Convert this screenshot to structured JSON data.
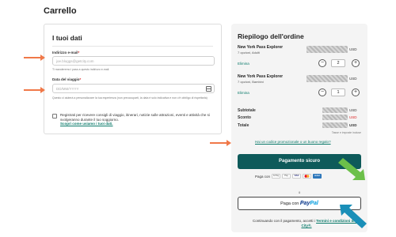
{
  "page": {
    "title": "Carrello"
  },
  "your_data": {
    "title": "I tuoi dati",
    "email": {
      "label": "Indirizzo e-mail",
      "required_mark": "*",
      "placeholder": "joe.bloggs@getcity.com",
      "help": "Ti manderemo i pass a questo indirizzo e-mail."
    },
    "travel_date": {
      "label": "Data del viaggio",
      "required_mark": "*",
      "placeholder": "DD/MM/YYYY",
      "help": "Questo ci aiuterà a personalizzare la tua esperienza (non preoccuparti, la data è solo indicativa e non c'è obbligo di rispettarla)"
    },
    "newsletter": {
      "text": "Registrati per ricevere consigli di viaggio, itinerari, notizie sulle attrazioni, eventi e attività che si svolgeranno durante il tuo soggiorno.",
      "link": "Scopri come usiamo i tuoi dati."
    }
  },
  "summary": {
    "title": "Riepilogo dell'ordine",
    "items": [
      {
        "name": "New York Pass Explorer",
        "options": "7 opzioni, Adulti",
        "remove": "Elimina",
        "currency": "USD",
        "quantity": "2"
      },
      {
        "name": "New York Pass Explorer",
        "options": "7 opzioni, Bambini",
        "remove": "Elimina",
        "currency": "USD",
        "quantity": "1"
      }
    ],
    "subtotal_label": "Subtotale",
    "discount_label": "Sconto",
    "total_label": "Totale",
    "currency": "USD",
    "taxes_note": "Tasse e imposte incluse",
    "promo_link": "Hai un codice promozionale o un buono regalo?",
    "pay_button": "Pagamento sicuro",
    "pay_with": "Paga con",
    "payment_methods": [
      "G Pay",
      "Pay",
      "VISA",
      "MC",
      "AMEX"
    ],
    "or": "o",
    "paypal_prefix": "Paga con",
    "paypal_pay": "Pay",
    "paypal_pal": "Pal",
    "terms_prefix": "Continuando con il pagamento, accetti i",
    "terms_link": "Termini e condizioni di Go City®."
  },
  "colors": {
    "accent": "#0e5a5a",
    "link": "#0a7a6a",
    "arrow_orange": "#f07848",
    "arrow_green": "#6cc04a",
    "arrow_teal": "#1a8fb8"
  }
}
